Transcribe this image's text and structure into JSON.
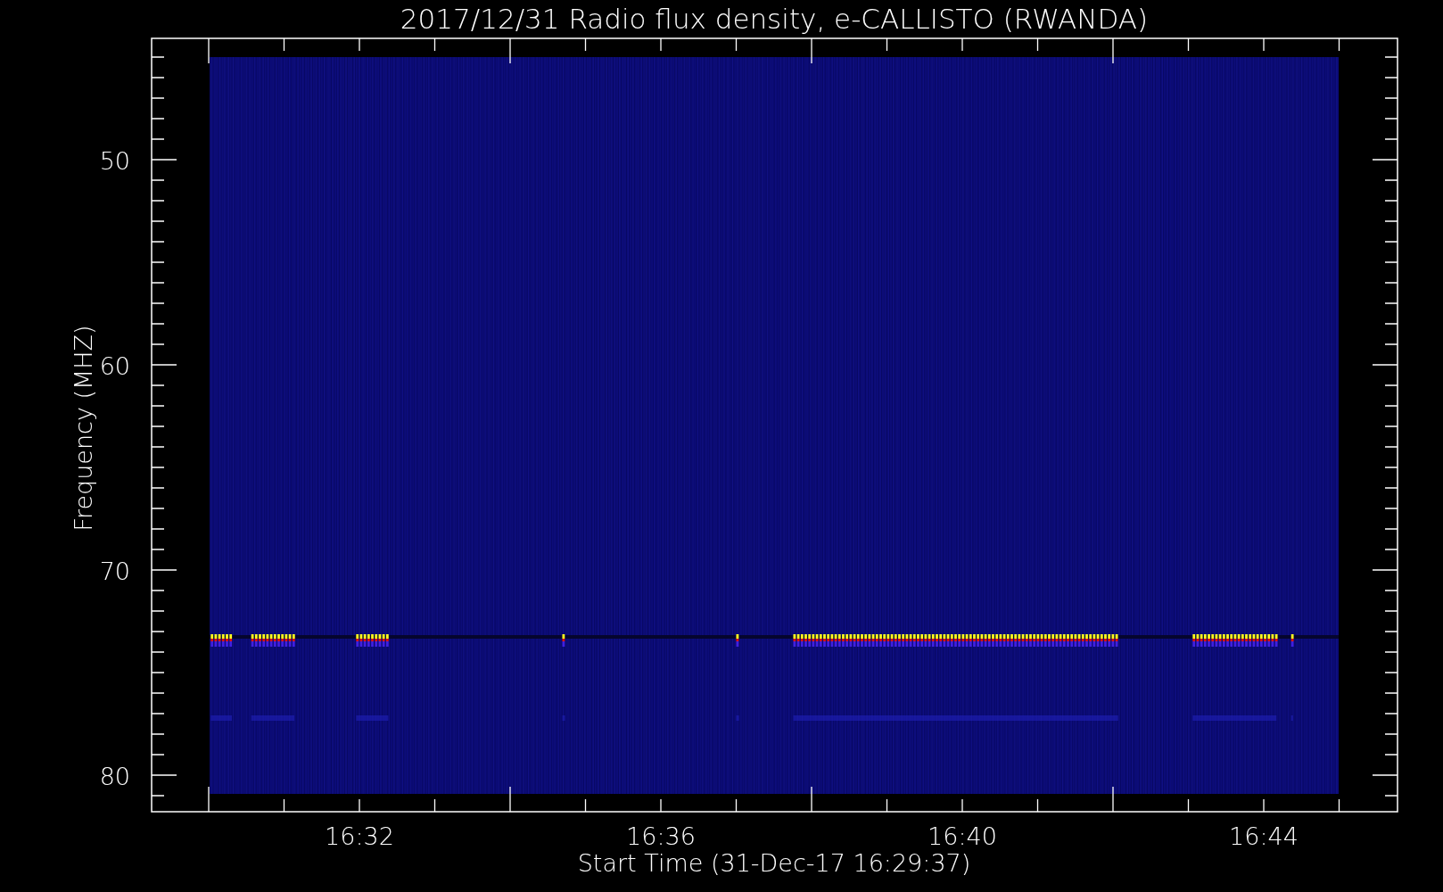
{
  "plot": {
    "title": "2017/12/31  Radio flux density, e-CALLISTO (RWANDA)",
    "y_axis": {
      "label": "Frequency (MHZ)",
      "ticks": [
        "50",
        "60",
        "70",
        "80"
      ]
    },
    "x_axis": {
      "label": "Start Time (31-Dec-17 16:29:37)",
      "ticks": [
        "16:32",
        "16:36",
        "16:40",
        "16:44"
      ]
    }
  }
}
